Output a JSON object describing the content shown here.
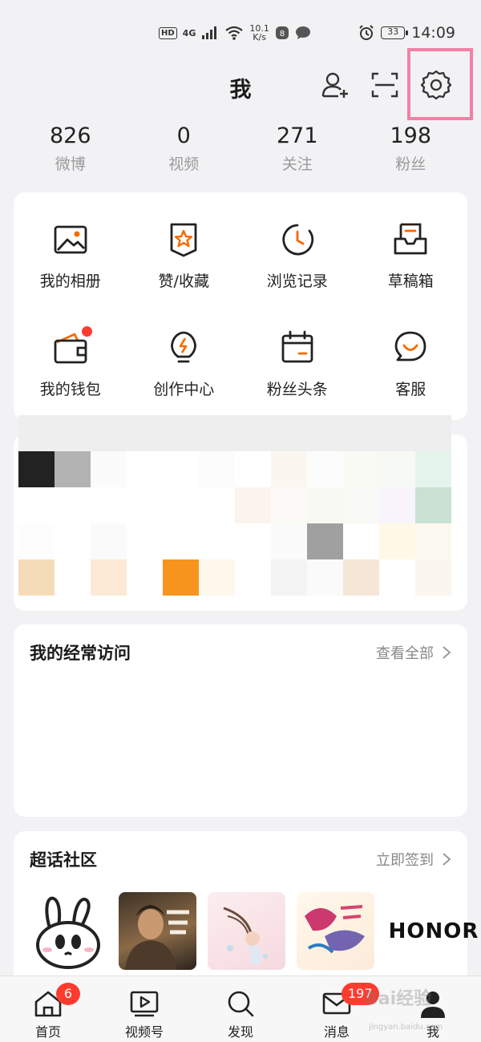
{
  "status_bar": {
    "hd": "HD",
    "network": "4G",
    "speed_value": "10.1",
    "speed_unit": "K/s",
    "battery": "33",
    "time": "14:09"
  },
  "header": {
    "title": "我"
  },
  "stats": [
    {
      "value": "826",
      "label": "微博"
    },
    {
      "value": "0",
      "label": "视频"
    },
    {
      "value": "271",
      "label": "关注"
    },
    {
      "value": "198",
      "label": "粉丝"
    }
  ],
  "tools": [
    {
      "label": "我的相册",
      "icon": "album-icon"
    },
    {
      "label": "赞/收藏",
      "icon": "favorite-icon"
    },
    {
      "label": "浏览记录",
      "icon": "history-icon"
    },
    {
      "label": "草稿箱",
      "icon": "drafts-icon"
    },
    {
      "label": "我的钱包",
      "icon": "wallet-icon"
    },
    {
      "label": "创作中心",
      "icon": "creator-icon"
    },
    {
      "label": "粉丝头条",
      "icon": "fans-headline-icon"
    },
    {
      "label": "客服",
      "icon": "customer-service-icon"
    }
  ],
  "frequent": {
    "title": "我的经常访问",
    "link": "查看全部"
  },
  "super_topic": {
    "title": "超话社区",
    "link": "立即签到",
    "brand_text": "HONOR"
  },
  "tabs": [
    {
      "label": "首页",
      "badge": "6",
      "icon": "home-icon"
    },
    {
      "label": "视频号",
      "badge": "",
      "icon": "video-icon"
    },
    {
      "label": "发现",
      "badge": "",
      "icon": "search-icon"
    },
    {
      "label": "消息",
      "badge": "197",
      "icon": "mail-icon"
    },
    {
      "label": "我",
      "badge": "",
      "icon": "profile-icon"
    }
  ],
  "watermark": {
    "text": "Bai经验",
    "sub": "jingyan.baidu.com"
  },
  "colors": {
    "accent": "#f56a00",
    "badge": "#ff3b30",
    "highlight": "#f47fa6"
  }
}
